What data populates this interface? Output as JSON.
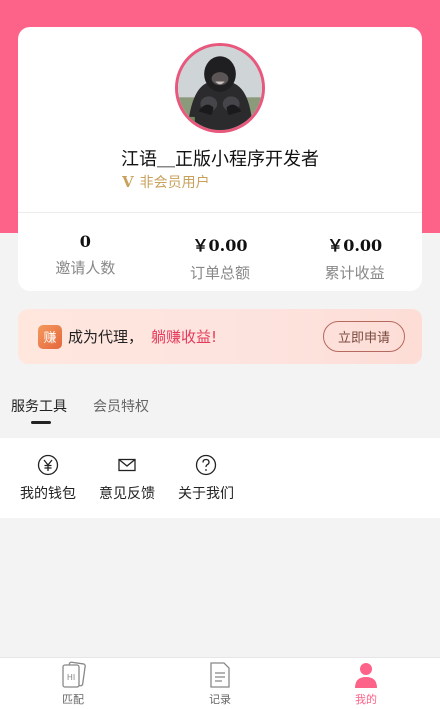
{
  "profile": {
    "name": "江语＿正版小程序开发者",
    "member_badge": "V",
    "member_status": "非会员用户"
  },
  "stats": [
    {
      "value": "0",
      "label": "邀请人数"
    },
    {
      "value": "￥0.00",
      "label": "订单总额"
    },
    {
      "value": "￥0.00",
      "label": "累计收益"
    }
  ],
  "agent_banner": {
    "icon_text": "赚",
    "text": "成为代理，",
    "slogan": "躺赚收益!",
    "apply_label": "立即申请"
  },
  "tabs": [
    {
      "label": "服务工具",
      "active": true
    },
    {
      "label": "会员特权",
      "active": false
    }
  ],
  "tools": [
    {
      "icon": "yen-circle-icon",
      "label": "我的钱包"
    },
    {
      "icon": "envelope-icon",
      "label": "意见反馈"
    },
    {
      "icon": "question-circle-icon",
      "label": "关于我们"
    }
  ],
  "bottom_nav": [
    {
      "icon": "hi-card-icon",
      "label": "匹配",
      "active": false
    },
    {
      "icon": "document-icon",
      "label": "记录",
      "active": false
    },
    {
      "icon": "person-icon",
      "label": "我的",
      "active": true
    }
  ],
  "colors": {
    "primary": "#fd6288",
    "member_gold": "#c9a15c",
    "slogan_red": "#e63a5c"
  }
}
